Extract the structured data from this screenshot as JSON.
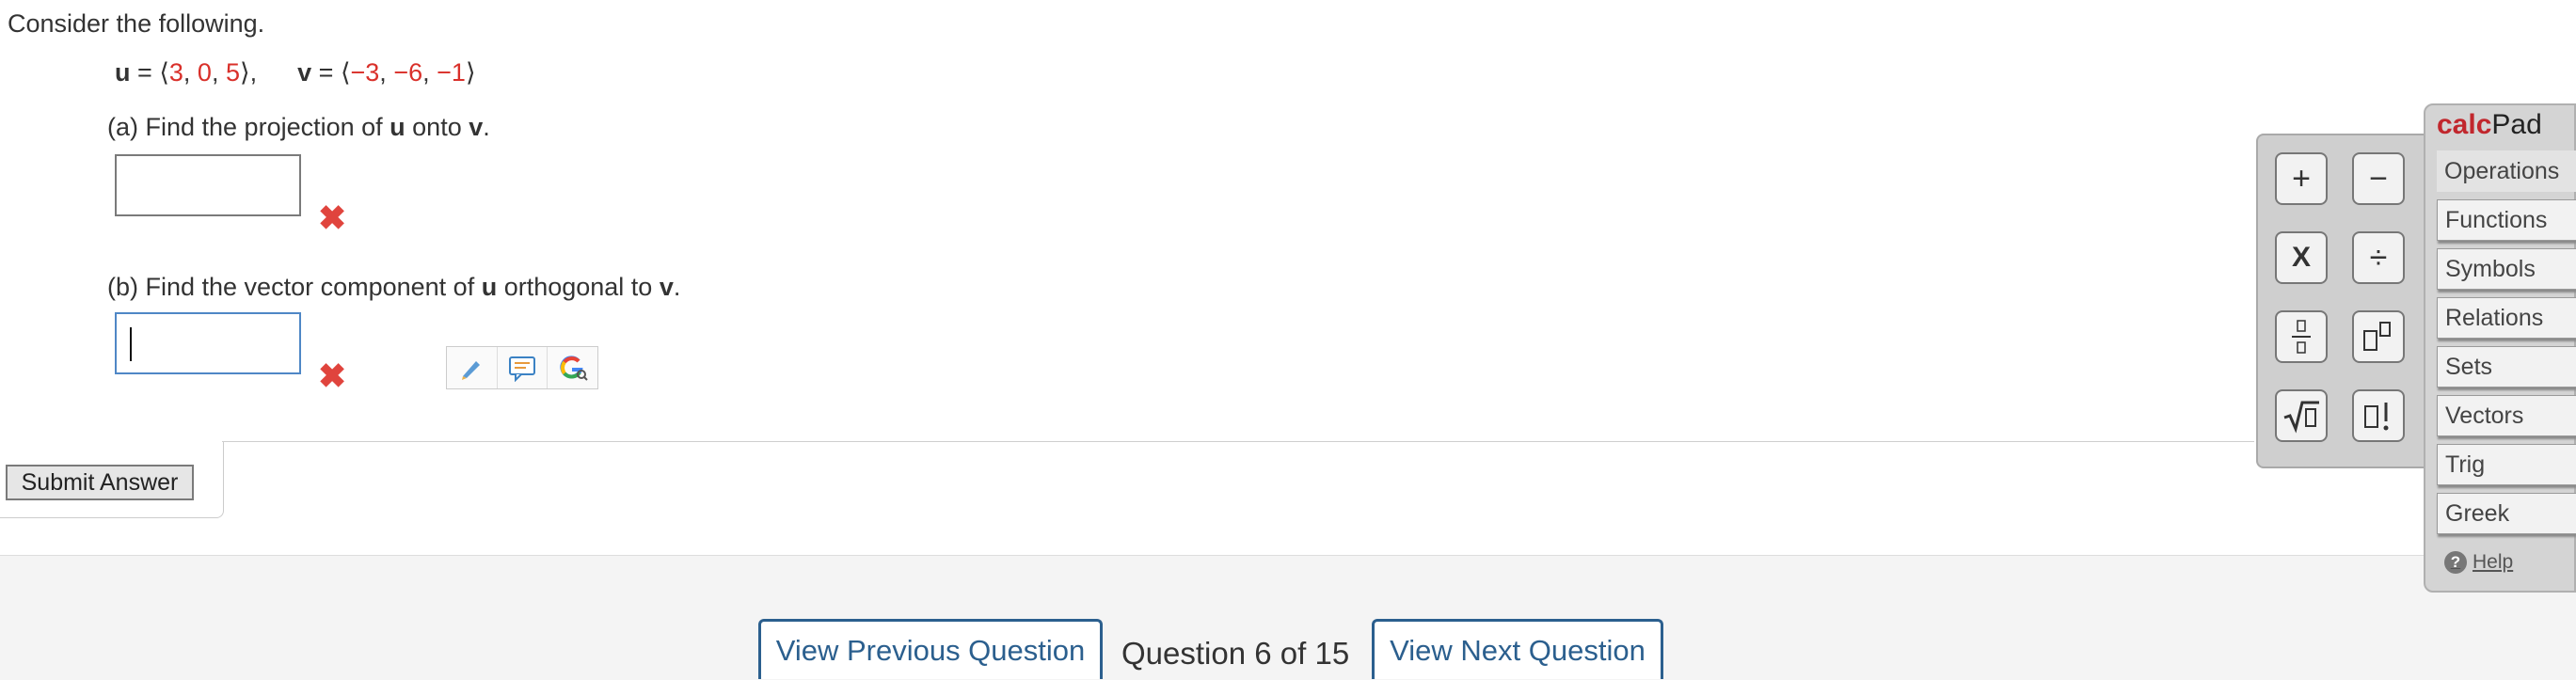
{
  "question": {
    "intro": "Consider the following.",
    "vectors": {
      "u_label": "u",
      "eq": "=",
      "u_open": "⟨",
      "u_values": [
        "3",
        "0",
        "5"
      ],
      "u_close": "⟩",
      "sep": ",",
      "v_label": "v",
      "v_open": "⟨",
      "v_values": [
        "−3",
        "−6",
        "−1"
      ],
      "v_close": "⟩"
    },
    "part_a": {
      "prefix": "(a) Find the projection of ",
      "u": "u",
      "middle": " onto ",
      "v": "v",
      "end": "."
    },
    "part_b": {
      "prefix": "(b) Find the vector component of ",
      "u": "u",
      "middle": " orthogonal to ",
      "v": "v",
      "end": "."
    },
    "incorrect_mark": "✖"
  },
  "submit": {
    "label": "Submit Answer"
  },
  "navigation": {
    "previous_label": "View Previous Question",
    "counter": "Question 6 of 15",
    "next_label": "View Next Question"
  },
  "calcpad": {
    "title_calc": "calc",
    "title_pad": "Pad",
    "buttons": [
      "+",
      "−",
      "X",
      "÷",
      "fraction",
      "exponent",
      "sqrt",
      "factorial"
    ],
    "menu": [
      "Operations",
      "Functions",
      "Symbols",
      "Relations",
      "Sets",
      "Vectors",
      "Trig",
      "Greek"
    ],
    "help_label": "Help"
  },
  "tools": [
    "pencil-icon",
    "comment-icon",
    "google-search-icon"
  ],
  "colors": {
    "accent_red": "#d9302a",
    "nav_blue": "#2b5f8e",
    "focus_blue": "#4f87c6"
  }
}
